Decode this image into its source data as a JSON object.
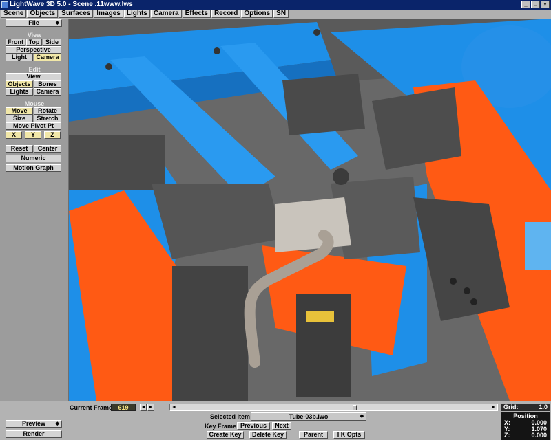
{
  "window": {
    "title": "LightWave 3D 5.0 - Scene .11www.lws",
    "minimize_glyph": "_",
    "maximize_glyph": "□",
    "close_glyph": "×"
  },
  "menu": [
    "Scene",
    "Objects",
    "Surfaces",
    "Images",
    "Lights",
    "Camera",
    "Effects",
    "Record",
    "Options",
    "SN"
  ],
  "left_panel": {
    "file": "File",
    "view_label": "View",
    "view_buttons": {
      "front": "Front",
      "top": "Top",
      "side": "Side",
      "perspective": "Perspective",
      "light": "Light",
      "camera": "Camera"
    },
    "edit_label": "Edit",
    "edit_buttons": {
      "view": "View",
      "objects": "Objects",
      "bones": "Bones",
      "lights": "Lights",
      "camera": "Camera"
    },
    "mouse_label": "Mouse",
    "mouse_buttons": {
      "move": "Move",
      "rotate": "Rotate",
      "size": "Size",
      "stretch": "Stretch",
      "move_pivot": "Move Pivot Pt",
      "x": "X",
      "y": "Y",
      "z": "Z"
    },
    "reset": "Reset",
    "center": "Center",
    "numeric": "Numeric",
    "motion_graph": "Motion Graph",
    "preview": "Preview",
    "render": "Render"
  },
  "timeline": {
    "current_frame_label": "Current Frame",
    "current_frame_value": "619",
    "prev": "◄",
    "next": "►",
    "slider_position": 0.56
  },
  "grid": {
    "label": "Grid:",
    "value": "1.0"
  },
  "selected_item": {
    "label": "Selected Item",
    "value": "Tube-03b.lwo"
  },
  "keyframe": {
    "label": "Key Frame",
    "previous": "Previous",
    "next": "Next",
    "create_key": "Create Key",
    "delete_key": "Delete Key",
    "parent": "Parent",
    "ik_opts": "I K Opts"
  },
  "position": {
    "title": "Position",
    "x_label": "X:",
    "x_value": "0.000",
    "y_label": "Y:",
    "y_value": "1.070",
    "z_label": "Z:",
    "z_value": "0.000"
  },
  "viewport": {
    "colors": {
      "blue": "#1e8fe8",
      "orange": "#ff5a14",
      "gray": "#5f5f5f",
      "steel": "#4a4a4a",
      "tube": "#a9a095"
    }
  }
}
